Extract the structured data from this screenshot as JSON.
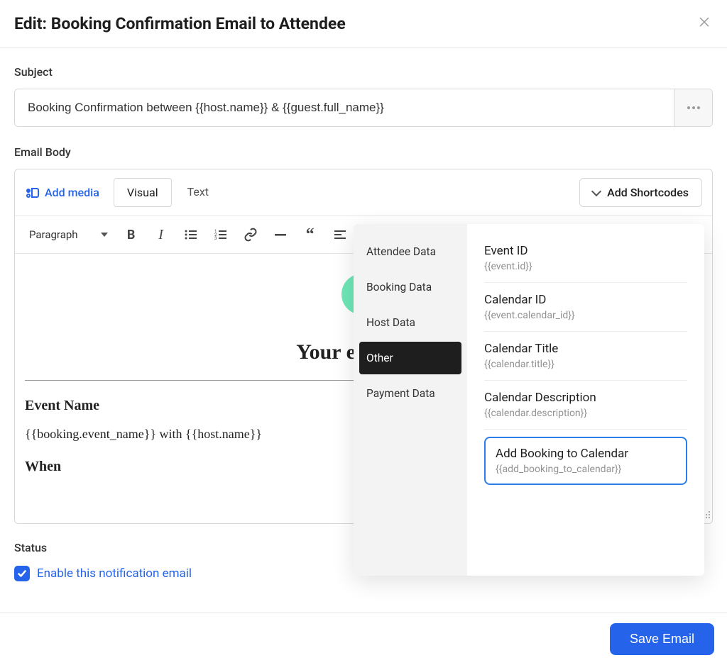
{
  "header": {
    "title": "Edit: Booking Confirmation Email to Attendee"
  },
  "subject": {
    "label": "Subject",
    "value": "Booking Confirmation between {{host.name}} & {{guest.full_name}}"
  },
  "body": {
    "label": "Email Body",
    "add_media": "Add media",
    "tabs": {
      "visual": "Visual",
      "text": "Text"
    },
    "add_shortcodes": "Add Shortcodes",
    "format_select": "Paragraph",
    "content": {
      "heading": "Your event has",
      "event_name_label": "Event Name",
      "event_name_value": "{{booking.event_name}} with {{host.name}}",
      "when_label": "When"
    }
  },
  "shortcodes": {
    "categories": [
      "Attendee Data",
      "Booking Data",
      "Host Data",
      "Other",
      "Payment Data"
    ],
    "active_category": "Other",
    "items": [
      {
        "title": "Event ID",
        "code": "{{event.id}}"
      },
      {
        "title": "Calendar ID",
        "code": "{{event.calendar_id}}"
      },
      {
        "title": "Calendar Title",
        "code": "{{calendar.title}}"
      },
      {
        "title": "Calendar Description",
        "code": "{{calendar.description}}"
      },
      {
        "title": "Add Booking to Calendar",
        "code": "{{add_booking_to_calendar}}"
      }
    ]
  },
  "status": {
    "label": "Status",
    "checkbox_label": "Enable this notification email"
  },
  "footer": {
    "save": "Save Email"
  }
}
